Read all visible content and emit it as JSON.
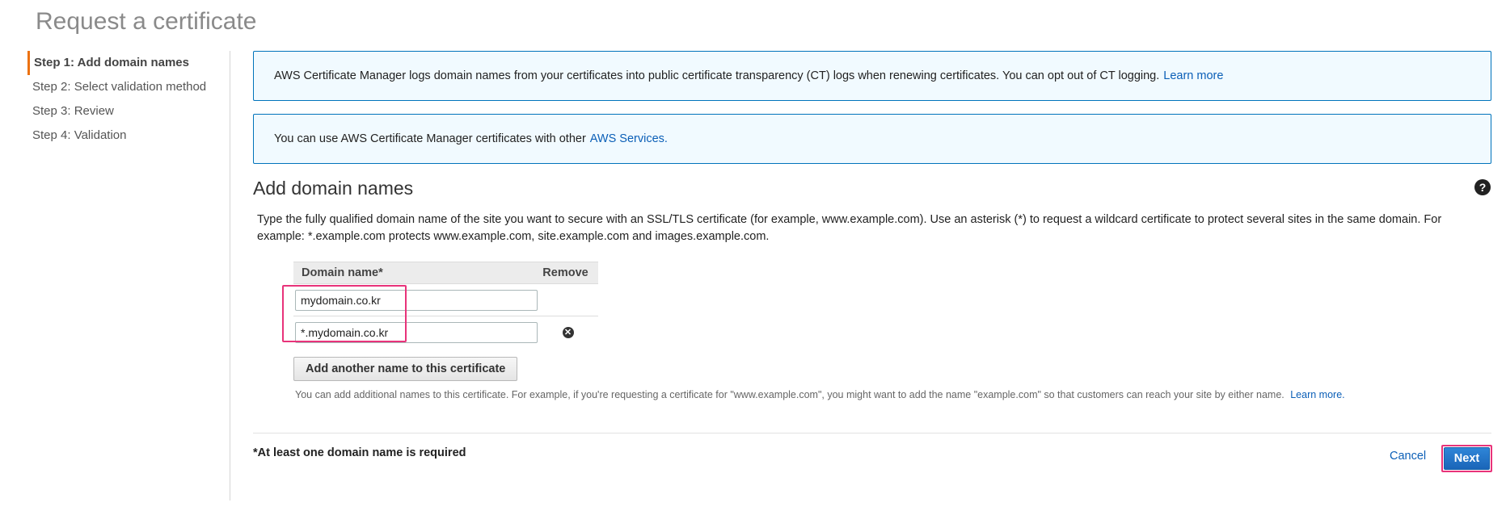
{
  "page": {
    "title": "Request a certificate"
  },
  "steps": [
    {
      "label": "Step 1: Add domain names",
      "active": true
    },
    {
      "label": "Step 2: Select validation method"
    },
    {
      "label": "Step 3: Review"
    },
    {
      "label": "Step 4: Validation"
    }
  ],
  "banners": {
    "ct_logging": {
      "text": "AWS Certificate Manager logs domain names from your certificates into public certificate transparency (CT) logs when renewing certificates. You can opt out of CT logging.",
      "link": "Learn more"
    },
    "services": {
      "text": "You can use AWS Certificate Manager certificates with other",
      "link": "AWS Services."
    }
  },
  "section": {
    "heading": "Add domain names",
    "description": "Type the fully qualified domain name of the site you want to secure with an SSL/TLS certificate (for example, www.example.com). Use an asterisk (*) to request a wildcard certificate to protect several sites in the same domain. For example: *.example.com protects www.example.com, site.example.com and images.example.com."
  },
  "domain_table": {
    "headers": {
      "name": "Domain name*",
      "remove": "Remove"
    },
    "rows": [
      {
        "value": "mydomain.co.kr"
      },
      {
        "value": "*.mydomain.co.kr"
      }
    ]
  },
  "add_name": {
    "button_label": "Add another name to this certificate",
    "hint": "You can add additional names to this certificate. For example, if you're requesting a certificate for \"www.example.com\", you might want to add the name \"example.com\" so that customers can reach your site by either name.",
    "hint_link": "Learn more."
  },
  "footer": {
    "required_note": "*At least one domain name is required",
    "cancel_label": "Cancel",
    "next_label": "Next"
  },
  "colors": {
    "highlight": "#e8337a",
    "link": "#0b5fb7",
    "accent_step": "#ec7211",
    "primary_button": "#1a65b8",
    "banner_border": "#0073bb"
  },
  "icons": {
    "help": "question-circle-icon",
    "remove": "x-circle-icon"
  }
}
